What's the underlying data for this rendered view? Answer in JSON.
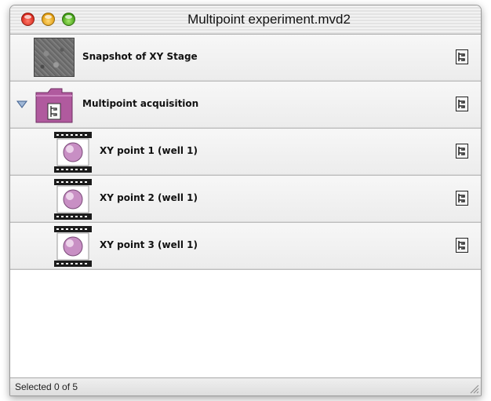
{
  "window": {
    "title": "Multipoint experiment.mvd2"
  },
  "items": [
    {
      "label": "Snapshot of XY Stage",
      "icon": "stage-snapshot-icon"
    },
    {
      "label": "Multipoint acquisition",
      "icon": "folder-icon",
      "expanded": true
    },
    {
      "label": "XY point 1 (well 1)",
      "icon": "film-icon"
    },
    {
      "label": "XY point 2 (well 1)",
      "icon": "film-icon"
    },
    {
      "label": "XY point 3 (well 1)",
      "icon": "film-icon"
    }
  ],
  "status": {
    "text": "Selected 0 of 5"
  },
  "colors": {
    "folder": "#b05a9e",
    "film_ball": "#c88fc4"
  }
}
